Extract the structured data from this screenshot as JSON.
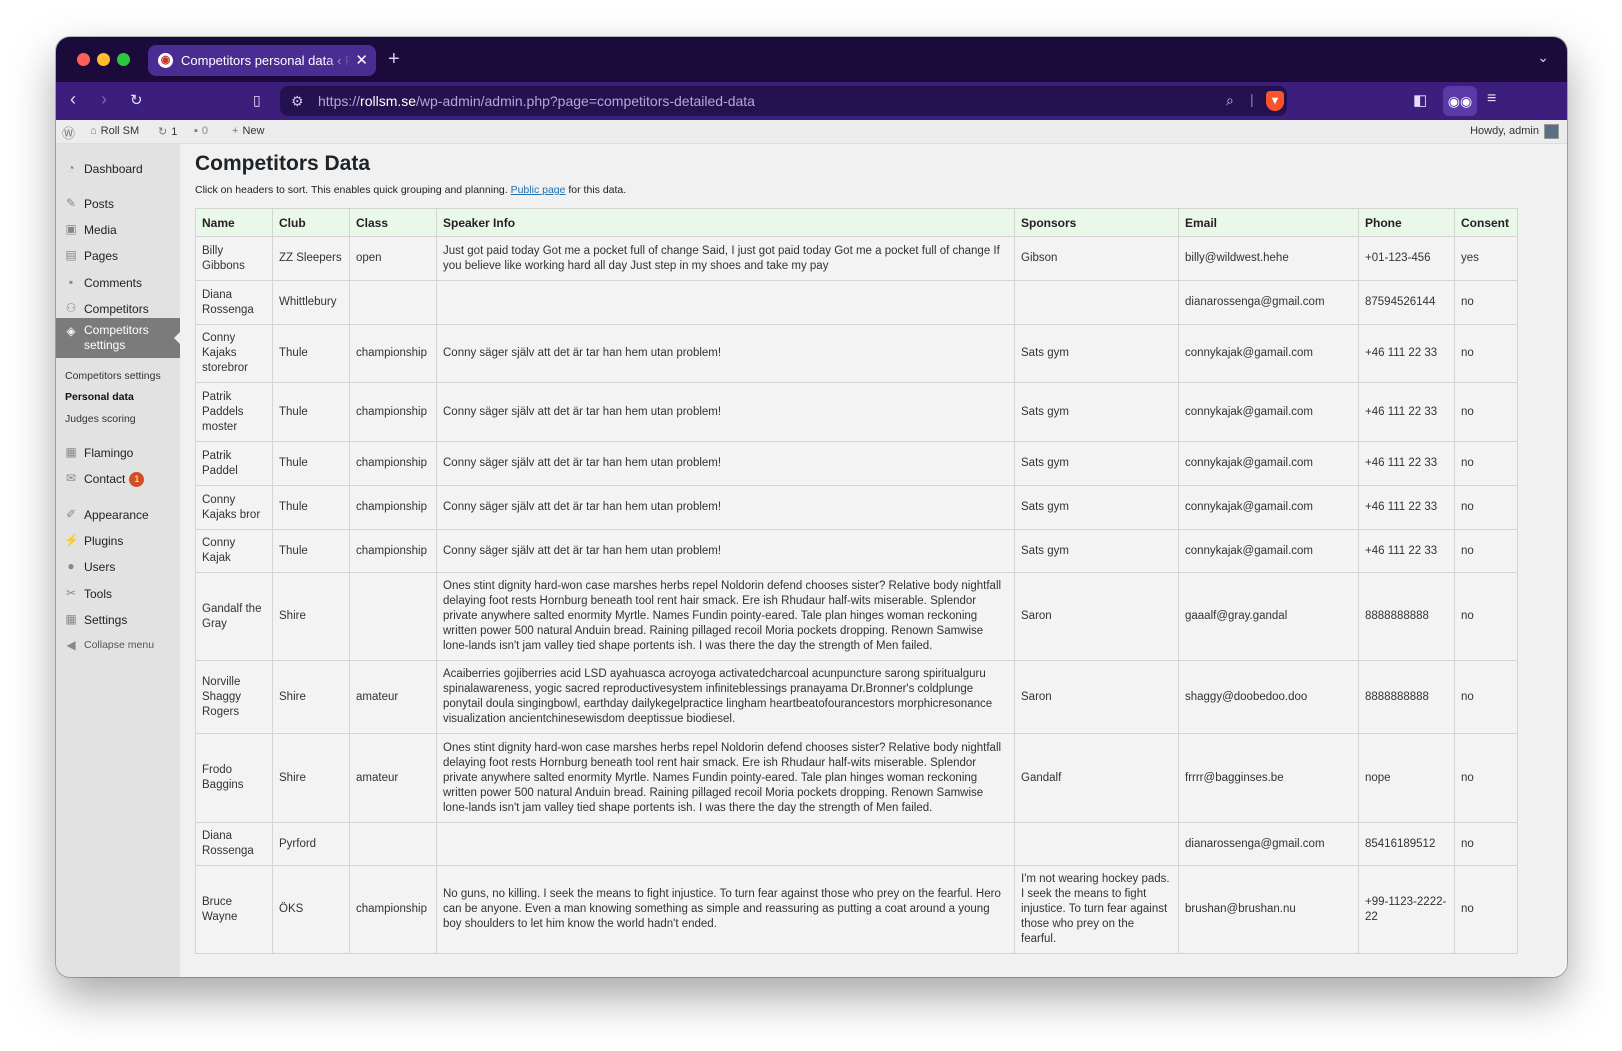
{
  "browser": {
    "tab_title": "Competitors personal data ‹ Roll SM",
    "new_tab_label": "+",
    "url_prefix": "https://",
    "url_domain": "rollsm.se",
    "url_path": "/wp-admin/admin.php?page=competitors-detailed-data"
  },
  "adminbar": {
    "site_name": "Roll SM",
    "updates_count": "1",
    "comments_count": "0",
    "new_label": "New",
    "greeting": "Howdy, admin"
  },
  "sidebar": {
    "items": [
      {
        "label": "Dashboard",
        "icon": "dashboard-icon"
      },
      {
        "label": "Posts",
        "icon": "pin-icon"
      },
      {
        "label": "Media",
        "icon": "media-icon"
      },
      {
        "label": "Pages",
        "icon": "pages-icon"
      },
      {
        "label": "Comments",
        "icon": "comment-icon"
      },
      {
        "label": "Competitors",
        "icon": "group-icon"
      },
      {
        "label": "Competitors settings",
        "icon": "tag-icon"
      },
      {
        "label": "Flamingo",
        "icon": "flamingo-icon"
      },
      {
        "label": "Contact",
        "icon": "mail-icon",
        "badge": "1"
      },
      {
        "label": "Appearance",
        "icon": "brush-icon"
      },
      {
        "label": "Plugins",
        "icon": "plug-icon"
      },
      {
        "label": "Users",
        "icon": "user-icon"
      },
      {
        "label": "Tools",
        "icon": "wrench-icon"
      },
      {
        "label": "Settings",
        "icon": "settings-icon"
      },
      {
        "label": "Collapse menu",
        "icon": "collapse-icon"
      }
    ],
    "submenu": [
      "Competitors settings",
      "Personal data",
      "Judges scoring"
    ]
  },
  "page": {
    "title": "Competitors Data",
    "intro_before": "Click on headers to sort. This enables quick grouping and planning. ",
    "intro_link": "Public page",
    "intro_after": " for this data."
  },
  "table": {
    "headers": [
      "Name",
      "Club",
      "Class",
      "Speaker Info",
      "Sponsors",
      "Email",
      "Phone",
      "Consent"
    ],
    "rows": [
      [
        "Billy Gibbons",
        "ZZ Sleepers",
        "open",
        "Just got paid today Got me a pocket full of change Said, I just got paid today Got me a pocket full of change If you believe like working hard all day Just step in my shoes and take my pay",
        "Gibson",
        "billy@wildwest.hehe",
        "+01-123-456",
        "yes"
      ],
      [
        "Diana Rossenga",
        "Whittlebury",
        "",
        "",
        "",
        "dianarossenga@gmail.com",
        "87594526144",
        "no"
      ],
      [
        "Conny Kajaks storebror",
        "Thule",
        "championship",
        "Conny säger själv att det är tar han hem utan problem!",
        "Sats gym",
        "connykajak@gamail.com",
        "+46 111 22 33",
        "no"
      ],
      [
        "Patrik Paddels moster",
        "Thule",
        "championship",
        "Conny säger själv att det är tar han hem utan problem!",
        "Sats gym",
        "connykajak@gamail.com",
        "+46 111 22 33",
        "no"
      ],
      [
        "Patrik Paddel",
        "Thule",
        "championship",
        "Conny säger själv att det är tar han hem utan problem!",
        "Sats gym",
        "connykajak@gamail.com",
        "+46 111 22 33",
        "no"
      ],
      [
        "Conny Kajaks bror",
        "Thule",
        "championship",
        "Conny säger själv att det är tar han hem utan problem!",
        "Sats gym",
        "connykajak@gamail.com",
        "+46 111 22 33",
        "no"
      ],
      [
        "Conny Kajak",
        "Thule",
        "championship",
        "Conny säger själv att det är tar han hem utan problem!",
        "Sats gym",
        "connykajak@gamail.com",
        "+46 111 22 33",
        "no"
      ],
      [
        "Gandalf the Gray",
        "Shire",
        "",
        "Ones stint dignity hard-won case marshes herbs repel Noldorin defend chooses sister? Relative body nightfall delaying foot rests Hornburg beneath tool rent hair smack. Ere ish Rhudaur half-wits miserable. Splendor private anywhere salted enormity Myrtle. Names Fundin pointy-eared. Tale plan hinges woman reckoning written power 500 natural Anduin bread. Raining pillaged recoil Moria pockets dropping. Renown Samwise lone-lands isn't jam valley tied shape portents ish. I was there the day the strength of Men failed.",
        "Saron",
        "gaaalf@gray.gandal",
        "8888888888",
        "no"
      ],
      [
        "Norville Shaggy Rogers",
        "Shire",
        "amateur",
        "Acaiberries gojiberries acid LSD ayahuasca acroyoga activatedcharcoal acunpuncture sarong spiritualguru spinalawareness, yogic sacred reproductivesystem infiniteblessings pranayama Dr.Bronner's coldplunge ponytail doula singingbowl, earthday dailykegelpractice lingham heartbeatofourancestors morphicresonance visualization ancientchinesewisdom deeptissue biodiesel.",
        "Saron",
        "shaggy@doobedoo.doo",
        "8888888888",
        "no"
      ],
      [
        "Frodo Baggins",
        "Shire",
        "amateur",
        "Ones stint dignity hard-won case marshes herbs repel Noldorin defend chooses sister? Relative body nightfall delaying foot rests Hornburg beneath tool rent hair smack. Ere ish Rhudaur half-wits miserable. Splendor private anywhere salted enormity Myrtle. Names Fundin pointy-eared. Tale plan hinges woman reckoning written power 500 natural Anduin bread. Raining pillaged recoil Moria pockets dropping. Renown Samwise lone-lands isn't jam valley tied shape portents ish. I was there the day the strength of Men failed.",
        "Gandalf",
        "frrrr@bagginses.be",
        "nope",
        "no"
      ],
      [
        "Diana Rossenga",
        "Pyrford",
        "",
        "",
        "",
        "dianarossenga@gmail.com",
        "85416189512",
        "no"
      ],
      [
        "Bruce Wayne",
        "ÖKS",
        "championship",
        "No guns, no killing. I seek the means to fight injustice. To turn fear against those who prey on the fearful. Hero can be anyone. Even a man knowing something as simple and reassuring as putting a coat around a young boy shoulders to let him know the world hadn't ended.",
        "I'm not wearing hockey pads. I seek the means to fight injustice. To turn fear against those who prey on the fearful.",
        "brushan@brushan.nu",
        "+99-1123-2222-22",
        "no"
      ]
    ]
  }
}
